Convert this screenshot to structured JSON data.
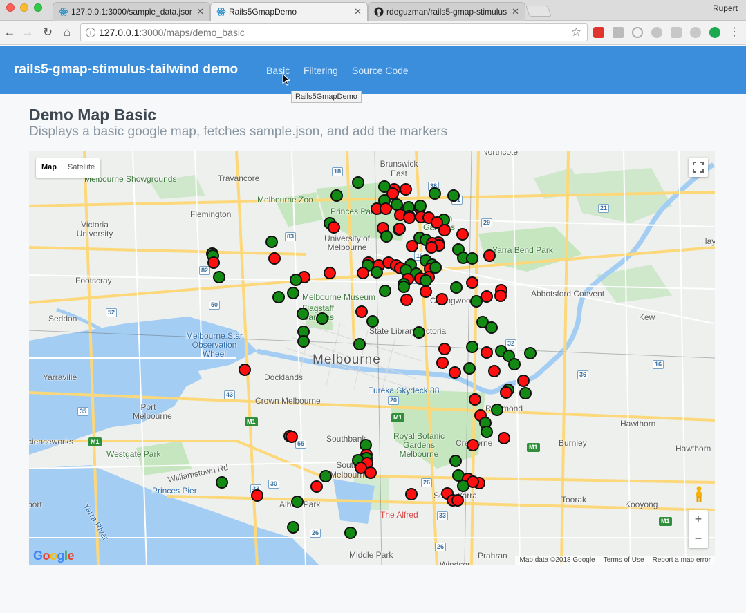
{
  "browser": {
    "tabs": [
      {
        "title": "127.0.0.1:3000/sample_data.json"
      },
      {
        "title": "Rails5GmapDemo"
      },
      {
        "title": "rdeguzman/rails5-gmap-stimulus-tailwind"
      }
    ],
    "profile": "Rupert",
    "url_host": "127.0.0.1",
    "url_path": ":3000/maps/demo_basic"
  },
  "header": {
    "brand": "rails5-gmap-stimulus-tailwind demo",
    "links": [
      "Basic",
      "Filtering",
      "Source Code"
    ],
    "tooltip": "Rails5GmapDemo"
  },
  "page": {
    "title": "Demo Map Basic",
    "subtitle": "Displays a basic google map, fetches sample.json, and add the markers"
  },
  "map": {
    "type_control": {
      "map": "Map",
      "satellite": "Satellite"
    },
    "zoom_in": "+",
    "zoom_out": "−",
    "attribution": {
      "data": "Map data ©2018 Google",
      "terms": "Terms of Use",
      "report": "Report a map error"
    },
    "logo": "Google",
    "labels": {
      "northcote": "Northcote",
      "brunswick_east": "Brunswick East",
      "travancore": "Travancore",
      "melbourne_showgrounds": "Melbourne Showgrounds",
      "melbourne_zoo": "Melbourne Zoo",
      "flemington": "Flemington",
      "princes_park": "Princes Park",
      "victoria_university": "Victoria University",
      "university_of_melbourne": "University of Melbourne",
      "carlton_gardens": "Carlton Gardens",
      "yarra_bend_park": "Yarra Bend Park",
      "footscray": "Footscray",
      "melbourne_museum": "Melbourne Museum",
      "abbotsford_convent": "Abbotsford Convent",
      "collingwood": "Collingwood",
      "seddon": "Seddon",
      "flagstaff_gardens": "Flagstaff Gardens",
      "kew": "Kew",
      "state_library_victoria": "State Library Victoria",
      "melbourne_star": "Melbourne Star Observation Wheel",
      "melbourne": "Melbourne",
      "yarraville": "Yarraville",
      "docklands": "Docklands",
      "eureka": "Eureka Skydeck 88",
      "crown": "Crown Melbourne",
      "port_melbourne": "Port Melbourne",
      "richmond": "Richmond",
      "hawthorn": "Hawthorn",
      "southbank": "Southbank",
      "royal_botanic": "Royal Botanic Gardens Melbourne",
      "cremorne": "Cremorne",
      "burnley": "Burnley",
      "hawthorn_right": "Hawthorn",
      "westgate_park": "Westgate Park",
      "scienceworks": "cienceworks",
      "williamstown_rd": "Williamstown Rd",
      "south_melbourne": "South Melbourne",
      "toorak": "Toorak",
      "princes_pier": "Princes Pier",
      "albert_park": "Albert Park",
      "south_yarra": "South Yarra",
      "kooyong": "Kooyong",
      "port": "port",
      "the_alfred": "The Alfred",
      "middle_park": "Middle Park",
      "prahran": "Prahran",
      "windsor": "Windsor",
      "yarra_river": "Yarra River",
      "hay": "Hay"
    },
    "marker_colors": {
      "red": "#ff1010",
      "green": "#138a13"
    }
  }
}
